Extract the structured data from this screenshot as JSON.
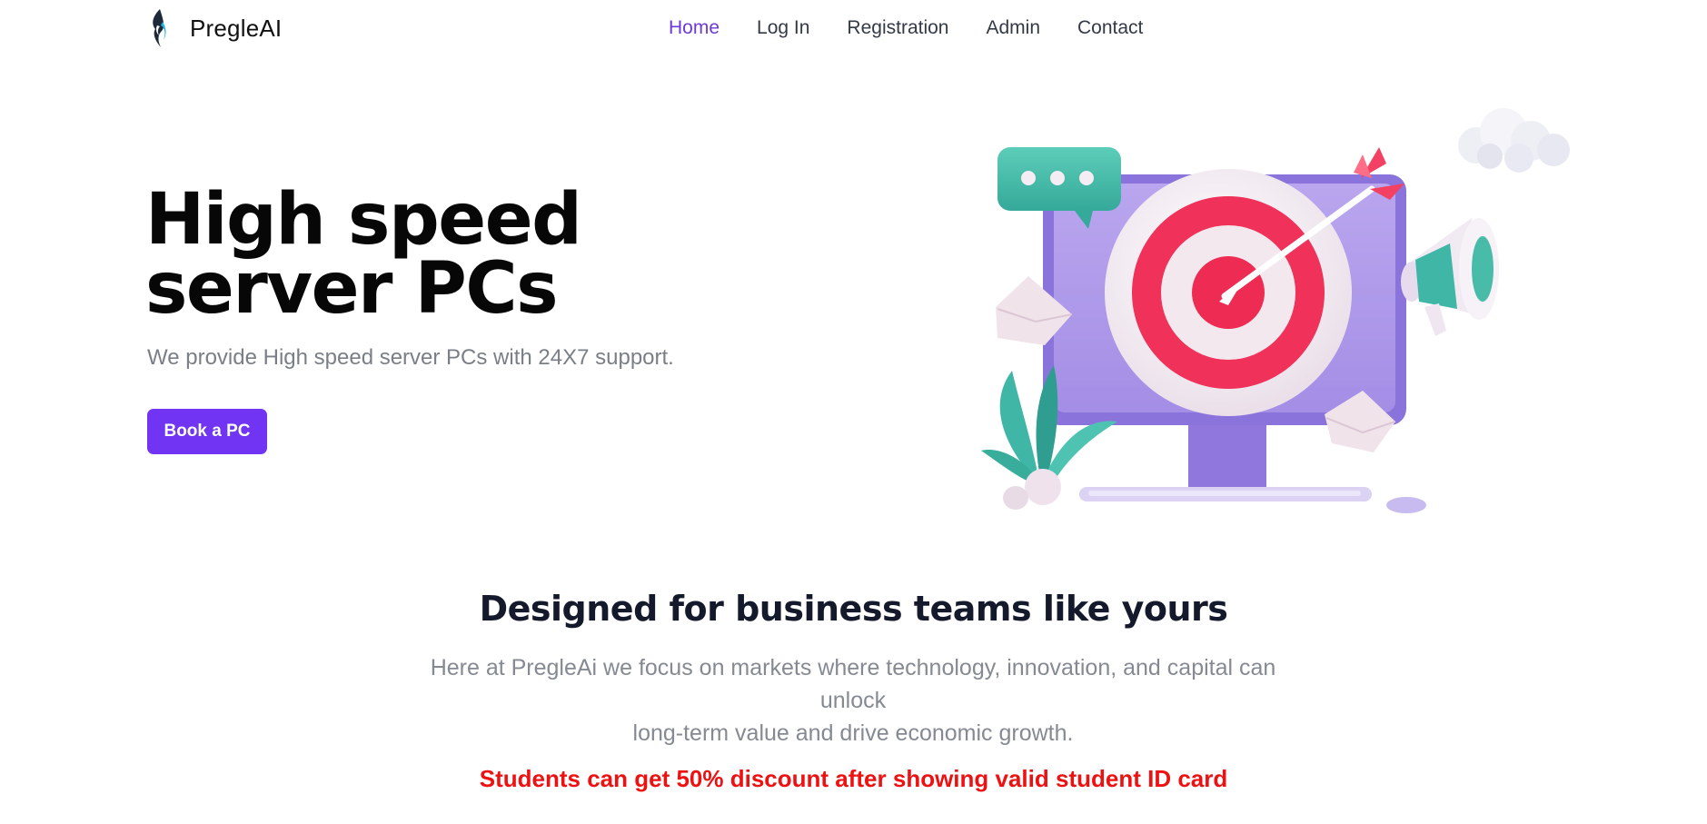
{
  "brand": {
    "name": "PregleAI",
    "logo_icon": "flame-logo-icon"
  },
  "nav": {
    "items": [
      {
        "label": "Home",
        "active": true
      },
      {
        "label": "Log In",
        "active": false
      },
      {
        "label": "Registration",
        "active": false
      },
      {
        "label": "Admin",
        "active": false
      },
      {
        "label": "Contact",
        "active": false
      }
    ]
  },
  "hero": {
    "title_line1": "High speed",
    "title_line2": "server PCs",
    "subtitle": "We provide High speed server PCs with 24X7 support.",
    "cta_label": "Book a PC",
    "illustration": "target-monitor-illustration"
  },
  "features": {
    "title": "Designed for business teams like yours",
    "description_line1": "Here at PregleAi we focus on markets where technology, innovation, and capital can unlock",
    "description_line2": "long-term value and drive economic growth.",
    "discount_note": "Students can get 50% discount after showing valid student ID card"
  },
  "colors": {
    "accent": "#7034f2",
    "nav_active": "#6d3ad8",
    "discount_text": "#ee1111"
  }
}
